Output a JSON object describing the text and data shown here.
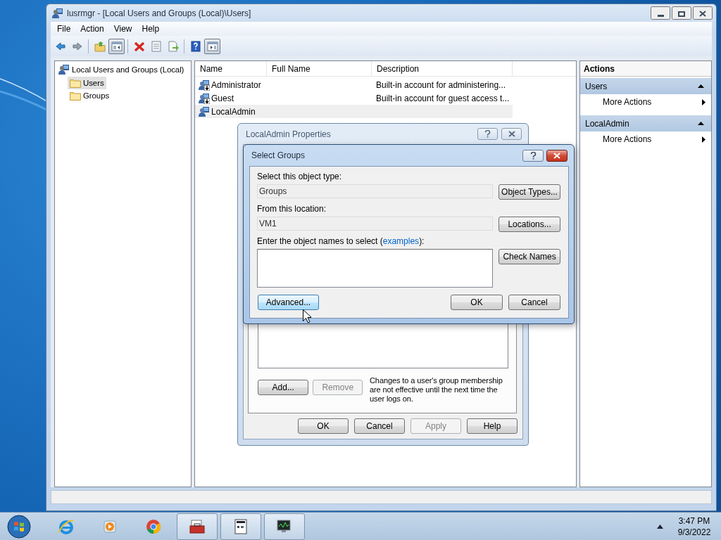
{
  "window": {
    "title": "lusrmgr - [Local Users and Groups (Local)\\Users]"
  },
  "menu": [
    "File",
    "Action",
    "View",
    "Help"
  ],
  "toolbar": [
    {
      "kind": "back",
      "pressed": false
    },
    {
      "kind": "forward",
      "pressed": false
    },
    {
      "kind": "up",
      "pressed": false
    },
    {
      "kind": "tree",
      "pressed": true
    },
    {
      "kind": "delete",
      "pressed": false
    },
    {
      "kind": "properties",
      "pressed": false
    },
    {
      "kind": "export",
      "pressed": false
    },
    {
      "kind": "help",
      "pressed": false
    },
    {
      "kind": "pane",
      "pressed": true
    }
  ],
  "tree": [
    {
      "label": "Local Users and Groups (Local)",
      "kind": "root",
      "selected": false,
      "children": [
        {
          "label": "Users",
          "kind": "folder",
          "selected": true
        },
        {
          "label": "Groups",
          "kind": "folder",
          "selected": false
        }
      ]
    }
  ],
  "list": {
    "columns": [
      "Name",
      "Full Name",
      "Description"
    ],
    "rows": [
      {
        "name": "Administrator",
        "description": "Built-in account for administering...",
        "disabled": true,
        "selected": false
      },
      {
        "name": "Guest",
        "description": "Built-in account for guest access t...",
        "disabled": true,
        "selected": false
      },
      {
        "name": "LocalAdmin",
        "disabled": false,
        "selected": true
      }
    ]
  },
  "actions": {
    "title": "Actions",
    "sections": [
      {
        "title": "Users",
        "expanded": true,
        "items": [
          "More Actions"
        ]
      },
      {
        "title": "LocalAdmin",
        "expanded": true,
        "items": [
          "More Actions"
        ]
      }
    ]
  },
  "properties_dialog": {
    "title": "LocalAdmin Properties",
    "buttons": [
      {
        "label": "Add...",
        "disabled": false
      },
      {
        "label": "Remove",
        "disabled": true
      }
    ],
    "note": "Changes to a user's group membership are not effective until the next time the user logs on.",
    "footer_buttons": [
      {
        "label": "OK",
        "disabled": false
      },
      {
        "label": "Cancel",
        "disabled": false
      },
      {
        "label": "Apply",
        "disabled": true
      },
      {
        "label": "Help",
        "disabled": false
      }
    ]
  },
  "select_dialog": {
    "title": "Select Groups",
    "object_type_label": "Select this object type:",
    "object_type": "Groups",
    "object_types_button": "Object Types...",
    "location_label": "From this location:",
    "location": "VM1",
    "locations_button": "Locations...",
    "names_label_before": "Enter the object names to select (",
    "names_link": "examples",
    "names_label_after": "):",
    "check_names_button": "Check Names",
    "advanced_button": {
      "label": "Advanced...",
      "hovered": true
    },
    "buttons": [
      "OK",
      "Cancel"
    ]
  },
  "taskbar": {
    "apps": [
      {
        "kind": "ie",
        "open": false
      },
      {
        "kind": "media",
        "open": false
      },
      {
        "kind": "chrome",
        "open": false
      },
      {
        "kind": "toolbox",
        "open": true
      },
      {
        "kind": "document",
        "open": true
      },
      {
        "kind": "monitor",
        "open": true
      }
    ],
    "time": "3:47 PM",
    "date": "9/3/2022"
  }
}
